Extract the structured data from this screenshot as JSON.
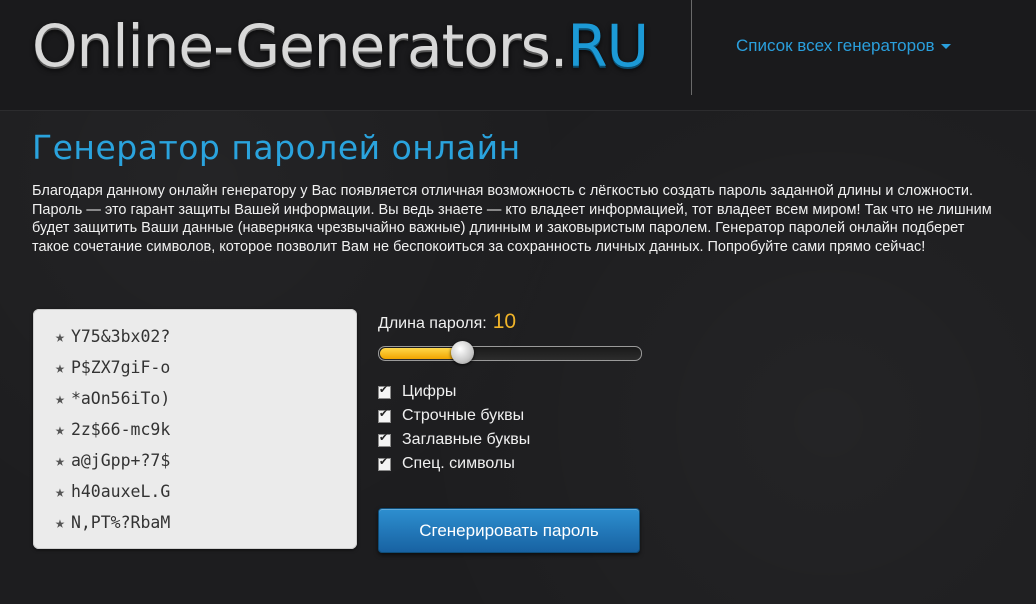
{
  "header": {
    "logo_main": "Online-Generators.",
    "logo_tld": "RU",
    "generators_menu_label": "Список всех генераторов",
    "generators_menu_icon": "caret-down-icon",
    "accent_color": "#2aa3dd"
  },
  "page": {
    "title": "Генератор паролей онлайн",
    "description": "Благодаря данному онлайн генератору у Вас появляется отличная возможность с лёгкостью создать пароль заданной длины и сложности. Пароль — это гарант защиты Вашей информации. Вы ведь знаете — кто владеет информацией, тот владеет всем миром! Так что не лишним будет защитить Ваши данные (наверняка чрезвычайно важные) длинным и заковыристым паролем. Генератор паролей онлайн подберет такое сочетание символов, которое позволит Вам не беспокоиться за сохранность личных данных. Попробуйте сами прямо сейчас!"
  },
  "passwords": {
    "bullet": "★",
    "items": [
      "Y75&3bx02?",
      "P$ZX7giF-o",
      "*aOn56iTo)",
      "2z$66-mc9k",
      "a@jGpp+?7$",
      "h40auxeL.G",
      "N,PT%?RbaM"
    ]
  },
  "controls": {
    "length_label": "Длина пароля:",
    "length_value": "10",
    "slider_fill_fraction": 0.33,
    "slider_fill_color": "#f0b429",
    "options": [
      {
        "label": "Цифры",
        "checked": true
      },
      {
        "label": "Строчные буквы",
        "checked": true
      },
      {
        "label": "Заглавные буквы",
        "checked": true
      },
      {
        "label": "Спец. символы",
        "checked": true
      }
    ],
    "generate_button_label": "Сгенерировать пароль",
    "button_color": "#1f74b8"
  }
}
